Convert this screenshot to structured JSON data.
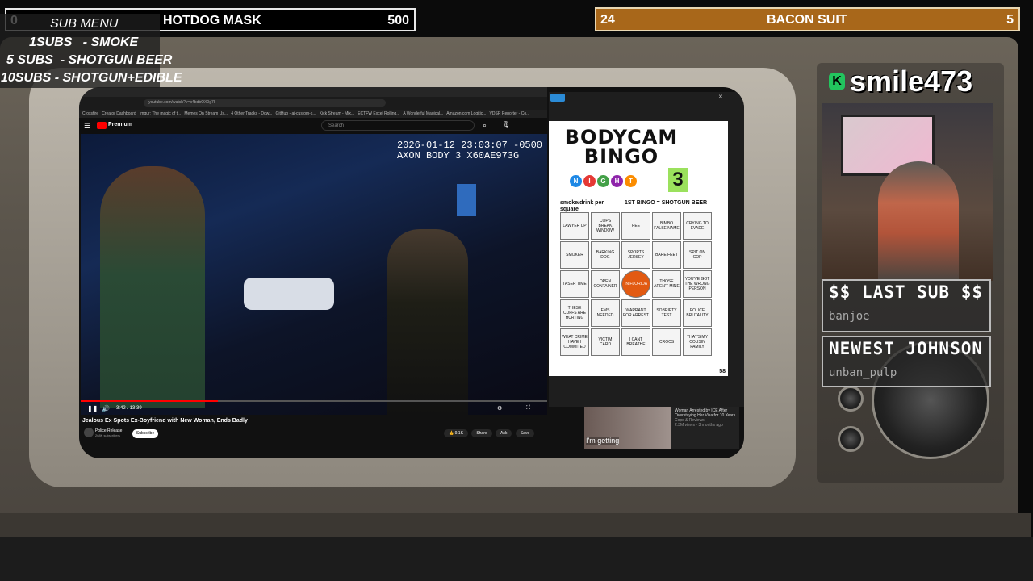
{
  "goal_bar_left": {
    "count": "0",
    "title": "HOTDOG MASK",
    "target": "500"
  },
  "goal_bar_right": {
    "count": "24",
    "title": "BACON SUIT",
    "target": "5"
  },
  "sub_menu": {
    "heading": "SUB MENU",
    "items": [
      "1SUBS   - SMOKE",
      "5 SUBS  - SHOTGUN BEER",
      "10SUBS - SHOTGUN+EDIBLE"
    ]
  },
  "streamer": {
    "name": "smile473"
  },
  "last_sub": {
    "heading": "$$ LAST SUB $$",
    "name": "banjoe"
  },
  "newest_follow": {
    "heading": "NEWEST JOHNSON",
    "name": "unban_pulp"
  },
  "browser": {
    "url": "youtube.com/watch?v=b4bdbOX0g7I",
    "bookmarks": [
      "Crossfire",
      "Creator Dashboard",
      "Imgur: The magic of t...",
      "Memes On Stream Us...",
      "4 Other Tracks - Dow...",
      "GitHub - ai-custom-s...",
      "Kick Stream - Mix...",
      "ECTFW Excel Rolling...",
      "A Wonderful Magical...",
      "Amazon.com Logitic...",
      "VDSR Reporter - Co..."
    ],
    "search_placeholder": "Search",
    "logo": "Premium"
  },
  "video": {
    "timestamp": "2026-01-12 23:03:07 -0500",
    "camera": "AXON BODY 3 X60AE973G",
    "time": "3:42 / 13:39",
    "title": "Jealous Ex Spots Ex-Boyfriend with New Woman, Ends Badly",
    "channel": "Police Release",
    "channel_subs": "268K subscribers",
    "subscribe_label": "Subscribe",
    "likes": "9.1K",
    "share_label": "Share",
    "ask_label": "Ask",
    "save_label": "Save"
  },
  "bingo": {
    "title1": "BODYCAM",
    "title2": "BINGO",
    "night_letters": [
      "N",
      "I",
      "G",
      "H",
      "T"
    ],
    "number": "3",
    "rule_left": "smoke/drink per square",
    "rule_right": "1ST BINGO = SHOTGUN BEER",
    "cells": [
      "LAWYER UP",
      "COPS BREAK WINDOW",
      "PEE",
      "BIMBO FALSE NAME",
      "CRYING TO EVADE",
      "SMOKER",
      "BARKING DOG",
      "SPORTS JERSEY",
      "BARE FEET",
      "SPIT ON COP",
      "TASER TIME",
      "OPEN CONTAINER",
      "IN FLORIDA",
      "THOSE AREN'T MINE",
      "YOU'VE GOT THE WRONG PERSON",
      "THESE CUFFS ARE HURTING",
      "EMS NEEDED",
      "WARRANT FOR ARREST",
      "SOBRIETY TEST",
      "POLICE BRUTALITY",
      "WHAT CRIME HAVE I COMMITED",
      "VICTIM CARD",
      "I CANT BREATHE",
      "CROCS",
      "THAT'S MY COUSIN FAMILY"
    ],
    "page": "58"
  },
  "up_next": {
    "caption": "I'm getting",
    "title": "Woman Arrested by ICE After Overstaying Her Visa for 10 Years",
    "channel": "Cops & Reviews",
    "meta": "2.3M views · 3 months ago"
  },
  "colors": {
    "goal_right": "#a8671a",
    "kick_green": "#22c55e",
    "yt_red": "#ff0000"
  }
}
